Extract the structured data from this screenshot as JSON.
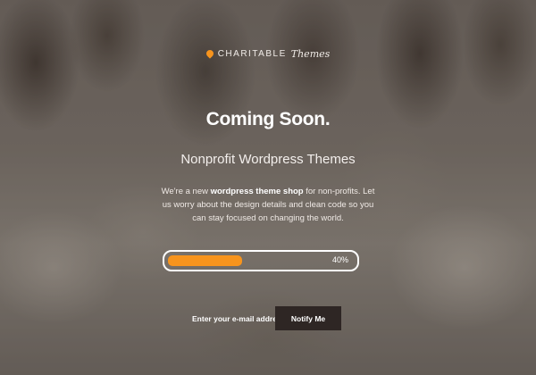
{
  "brand": {
    "name": "CHARITABLE",
    "script": "Themes",
    "accent_color": "#f7941d",
    "icon": "map-pin-icon"
  },
  "hero": {
    "title": "Coming Soon.",
    "subtitle": "Nonprofit Wordpress Themes",
    "description": {
      "part1": "We're a new ",
      "bold": "wordpress theme shop",
      "part2": " for non-profits. Let us worry about the design details and clean code so you can stay focused on changing the world."
    }
  },
  "progress": {
    "percent": 40,
    "label": "40%",
    "fill_color": "#f7941d"
  },
  "signup": {
    "placeholder": "Enter your e-mail address",
    "button_label": "Notify Me",
    "button_color": "#2e2624"
  }
}
